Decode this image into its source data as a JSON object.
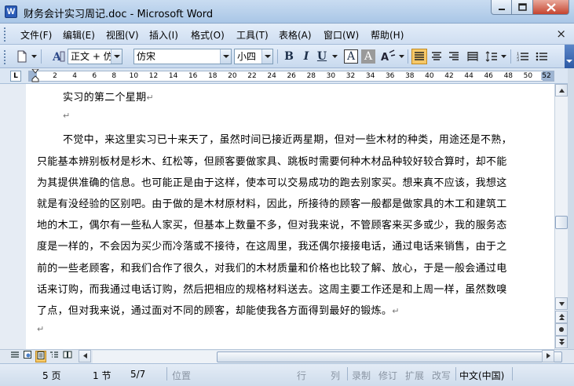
{
  "window": {
    "title": "财务会计实习周记.doc - Microsoft Word",
    "app_icon_letter": "W"
  },
  "menu": {
    "items": [
      "文件(F)",
      "编辑(E)",
      "视图(V)",
      "插入(I)",
      "格式(O)",
      "工具(T)",
      "表格(A)",
      "窗口(W)",
      "帮助(H)"
    ],
    "close_doc": "×"
  },
  "toolbar": {
    "style_value": "正文 + 仿末",
    "font_value": "仿宋",
    "size_value": "小四",
    "bold": "B",
    "italic": "I",
    "underline": "U",
    "char_border": "A",
    "char_shading": "A",
    "icons": {
      "new": "new-document-icon",
      "styles": "styles-pane-icon",
      "highlight": "highlight-icon"
    }
  },
  "ruler": {
    "tab_marker": "L",
    "ticks": [
      "2",
      "4",
      "6",
      "8",
      "10",
      "12",
      "14",
      "16",
      "18",
      "20",
      "22",
      "24",
      "26",
      "28",
      "30",
      "32",
      "34",
      "36",
      "38",
      "40",
      "42",
      "44",
      "46",
      "48",
      "50"
    ],
    "end_tick": "52"
  },
  "document": {
    "lines": [
      "实习的第二个星期",
      "",
      "不觉中，来这里实习已十来天了，虽然时间已接近两星期，但对一些木材的种类，用途还是不熟，",
      "只能基本辨别板材是杉木、红松等，但顾客要做家具、跳板时需要何种木材品种较好较合算时，却不能",
      "为其提供准确的信息。也可能正是由于这样，使本可以交易成功的跑去别家买。想来真不应该，我想这",
      "就是有没经验的区别吧。由于做的是木材原材料，因此，所接待的顾客一般都是做家具的木工和建筑工",
      "地的木工，偶尔有一些私人家买，但基本上数量不多，但对我来说，不管顾客来买多或少，我的服务态",
      "度是一样的，不会因为买少而冷落或不接待，在这周里，我还偶尔接接电话，通过电话来销售，由于之",
      "前的一些老顾客，和我们合作了很久，对我们的木材质量和价格也比较了解、放心，于是一般会通过电",
      "话来订购，而我通过电话订购，然后把相应的规格材料送去。这周主要工作还是和上周一样，虽然数嗅",
      "了点，但对我来说，通过面对不同的顾客，却能使我各方面得到最好的锻炼。",
      ""
    ],
    "para_mark": "↵"
  },
  "status": {
    "page": "5 页",
    "section": "1 节",
    "page_of": "5/7",
    "position": "位置",
    "line": "行",
    "column": "列",
    "rec": "录制",
    "trk": "修订",
    "ext": "扩展",
    "ovr": "改写",
    "language": "中文(中国)"
  },
  "colors": {
    "titlebar": "#b9d1ea",
    "highlight_active": "#f5c868",
    "page": "#ffffff"
  }
}
